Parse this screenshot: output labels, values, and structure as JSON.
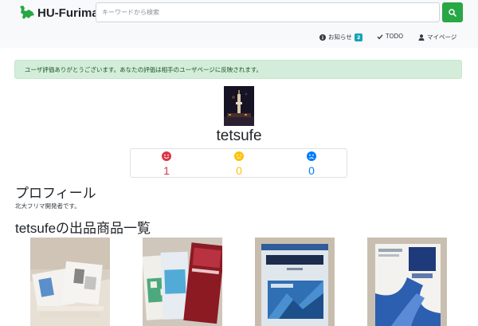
{
  "header": {
    "brand": "HU-Furima",
    "search_placeholder": "キーワードから検索"
  },
  "nav": {
    "notifications_label": "お知らせ",
    "notifications_count": "2",
    "todo_label": "TODO",
    "mypage_label": "マイページ"
  },
  "alert": {
    "message": "ユーザ評価ありがとうございます。あなたの評価は相手のユーザページに反映されます。"
  },
  "user": {
    "name": "tetsufe"
  },
  "ratings": {
    "good": "1",
    "normal": "0",
    "bad": "0",
    "colors": {
      "good": "#dc3545",
      "normal": "#ffc107",
      "bad": "#007bff"
    }
  },
  "profile": {
    "heading": "プロフィール",
    "text": "北大フリマ開発者です。"
  },
  "listings": {
    "heading": "tetsufeの出品商品一覧",
    "products": [
      {
        "image": "stack-of-books-photo"
      },
      {
        "image": "electronics-engineering-books-photo"
      },
      {
        "image": "statistics-textbook-photo"
      },
      {
        "image": "calculus-textbook-photo"
      }
    ]
  }
}
